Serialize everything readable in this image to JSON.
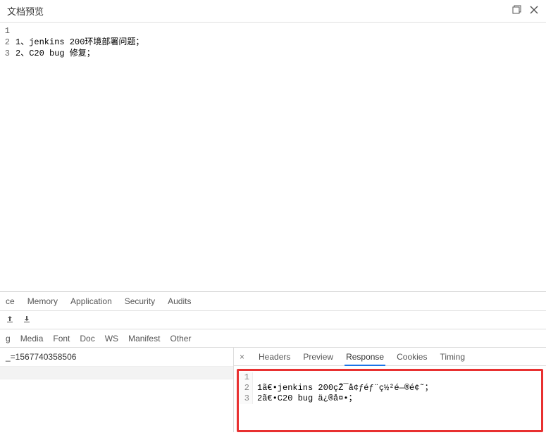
{
  "preview": {
    "title": "文档预览",
    "lines": [
      {
        "num": "1",
        "text": ""
      },
      {
        "num": "2",
        "text": "1、jenkins 200环境部署问题；"
      },
      {
        "num": "3",
        "text": "2、C20 bug 修复；"
      }
    ]
  },
  "devtools": {
    "top_tabs": {
      "ce": "ce",
      "memory": "Memory",
      "application": "Application",
      "security": "Security",
      "audits": "Audits"
    },
    "filter_tabs": {
      "g": "g",
      "media": "Media",
      "font": "Font",
      "doc": "Doc",
      "ws": "WS",
      "manifest": "Manifest",
      "other": "Other"
    },
    "request": {
      "text": "_=1567740358506"
    },
    "response_tabs": {
      "headers": "Headers",
      "preview": "Preview",
      "response": "Response",
      "cookies": "Cookies",
      "timing": "Timing"
    },
    "response_lines": [
      {
        "num": "1",
        "text": ""
      },
      {
        "num": "2",
        "text": "1ã€•jenkins 200çŽ¯å¢ƒéƒ¨ç½²é—®é¢˜；"
      },
      {
        "num": "3",
        "text": "2ã€•C20 bug ä¿®å¤•；"
      }
    ]
  }
}
